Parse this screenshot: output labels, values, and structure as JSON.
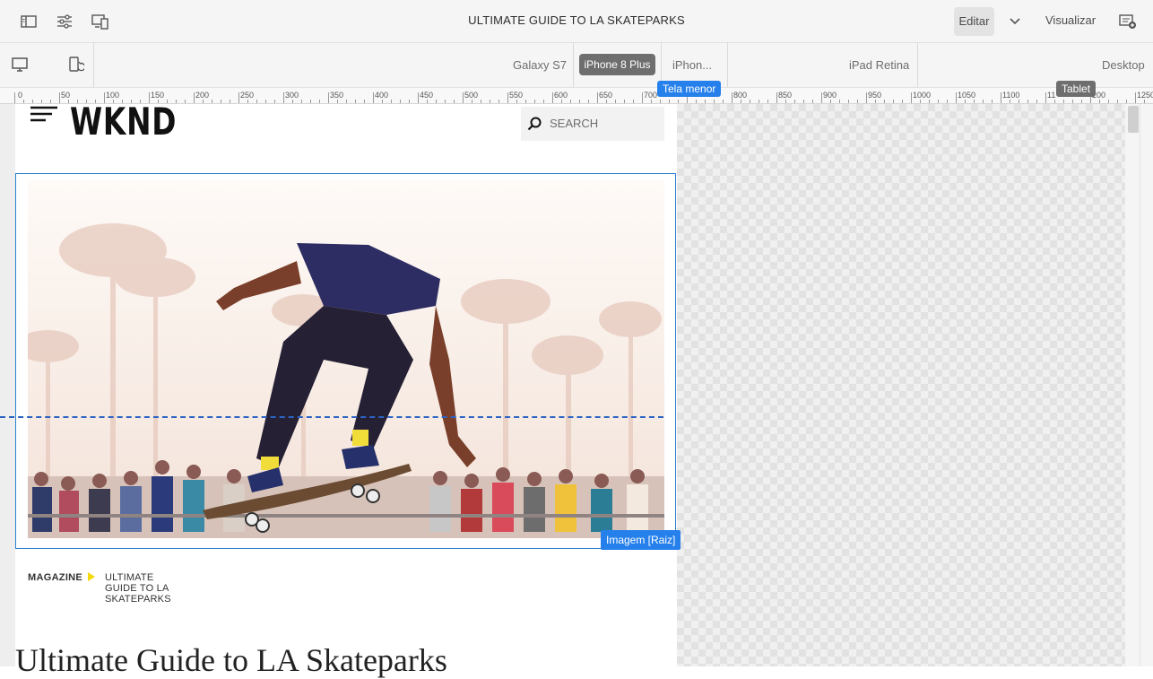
{
  "topbar": {
    "page_title": "ULTIMATE GUIDE TO LA SKATEPARKS",
    "edit_label": "Editar",
    "preview_label": "Visualizar",
    "icons": [
      "side-panel-icon",
      "page-properties-icon",
      "emulator-icon",
      "chevron-down-icon",
      "annotations-icon"
    ]
  },
  "devices": {
    "items": [
      "Galaxy S7",
      "iPhone 8 Plus",
      "iPhon...",
      "iPad Retina",
      "Desktop"
    ],
    "active": "iPhone 8 Plus",
    "icons": [
      "desktop-icon",
      "rotate-device-icon"
    ]
  },
  "ruler": {
    "labels": [
      "0",
      "50",
      "100",
      "150",
      "200",
      "250",
      "300",
      "350",
      "400",
      "450",
      "500",
      "550",
      "600",
      "650",
      "700",
      "800",
      "850",
      "900",
      "950",
      "1000",
      "1050",
      "1100",
      "11",
      "200",
      "1250"
    ],
    "markers": [
      "Tela menor",
      "Tablet"
    ]
  },
  "site": {
    "logo": "WKND",
    "search_placeholder": "SEARCH",
    "image_badge": "Imagem [Raiz]",
    "breadcrumb": [
      "MAGAZINE",
      "ULTIMATE GUIDE TO LA SKATEPARKS"
    ],
    "heading": "Ultimate Guide to LA Skateparks"
  },
  "colors": {
    "accent": "#2680eb",
    "breadcrumb_arrow": "#f5d90a",
    "active_device_bg": "#6e6e6e"
  }
}
